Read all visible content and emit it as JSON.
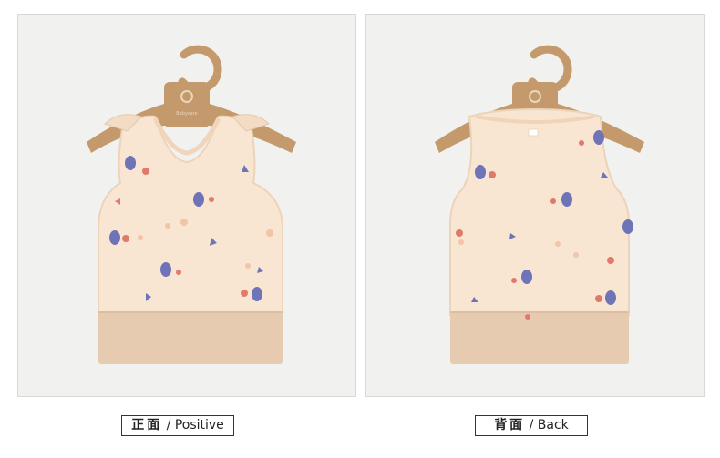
{
  "captions": {
    "front": {
      "zh": "正面",
      "en": " / Positive"
    },
    "back": {
      "zh": "背面",
      "en": " / Back"
    }
  },
  "hanger_brand": "Babycare",
  "colors": {
    "fabric": "#f8e6d3",
    "fabric_shadow": "#ecd3b9",
    "hem_band": "#e6cbb0",
    "hanger": "#c49a6c",
    "print_blue": "#6f74b8",
    "print_red": "#e07a6a",
    "panel_bg": "#f1f1ef"
  },
  "icons": [
    "hanger-icon",
    "tank-top-front-image",
    "tank-top-back-image"
  ]
}
